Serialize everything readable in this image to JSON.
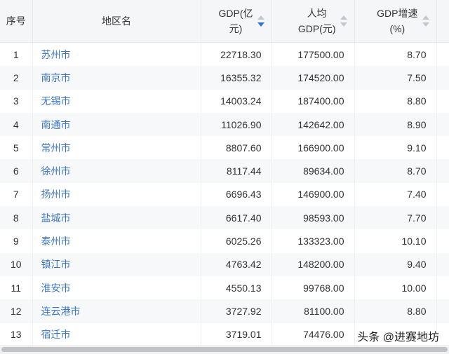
{
  "headers": {
    "index": "序号",
    "region": "地区名",
    "gdp_line1": "GDP(亿",
    "gdp_line2": "元)",
    "per_capita_line1": "人均",
    "per_capita_line2": "GDP(元)",
    "growth_line1": "GDP增速",
    "growth_line2": "(%)"
  },
  "sort": {
    "active_column": "gdp",
    "direction": "descending",
    "active_color": "#3372d6"
  },
  "rows": [
    {
      "index": "1",
      "name": "苏州市",
      "gdp": "22718.30",
      "per_capita": "177500.00",
      "growth": "8.70"
    },
    {
      "index": "2",
      "name": "南京市",
      "gdp": "16355.32",
      "per_capita": "174520.00",
      "growth": "7.50"
    },
    {
      "index": "3",
      "name": "无锡市",
      "gdp": "14003.24",
      "per_capita": "187400.00",
      "growth": "8.80"
    },
    {
      "index": "4",
      "name": "南通市",
      "gdp": "11026.90",
      "per_capita": "142642.00",
      "growth": "8.90"
    },
    {
      "index": "5",
      "name": "常州市",
      "gdp": "8807.60",
      "per_capita": "166900.00",
      "growth": "9.10"
    },
    {
      "index": "6",
      "name": "徐州市",
      "gdp": "8117.44",
      "per_capita": "89634.00",
      "growth": "8.70"
    },
    {
      "index": "7",
      "name": "扬州市",
      "gdp": "6696.43",
      "per_capita": "146900.00",
      "growth": "7.40"
    },
    {
      "index": "8",
      "name": "盐城市",
      "gdp": "6617.40",
      "per_capita": "98593.00",
      "growth": "7.70"
    },
    {
      "index": "9",
      "name": "泰州市",
      "gdp": "6025.26",
      "per_capita": "133323.00",
      "growth": "10.10"
    },
    {
      "index": "10",
      "name": "镇江市",
      "gdp": "4763.42",
      "per_capita": "148200.00",
      "growth": "9.40"
    },
    {
      "index": "11",
      "name": "淮安市",
      "gdp": "4550.13",
      "per_capita": "99768.00",
      "growth": "10.00"
    },
    {
      "index": "12",
      "name": "连云港市",
      "gdp": "3727.92",
      "per_capita": "81100.00",
      "growth": "8.80"
    },
    {
      "index": "13",
      "name": "宿迁市",
      "gdp": "3719.01",
      "per_capita": "74476.00",
      "growth": ""
    }
  ],
  "watermark": "头条 @进赛地坊",
  "colors": {
    "link": "#3a75c4",
    "header_bg": "#f5f6f8",
    "stripe_bg": "#f6f8fa"
  }
}
